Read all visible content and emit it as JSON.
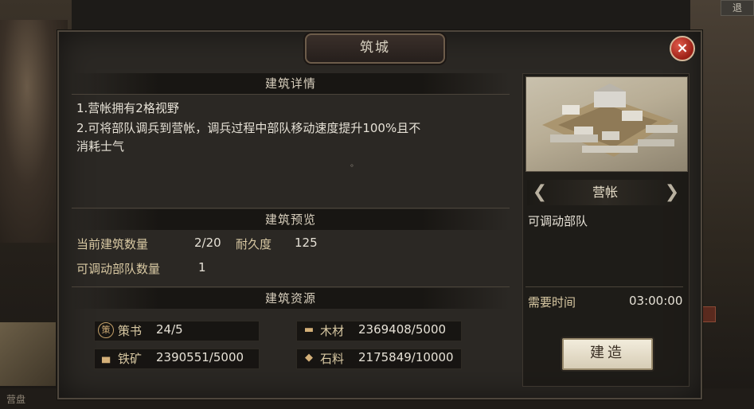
{
  "background": {
    "top_right_button": "退",
    "bottom_left_label": "营盘"
  },
  "dialog": {
    "title": "筑城",
    "close_symbol": "×"
  },
  "details": {
    "header": "建筑详情",
    "line1": "1.营帐拥有2格视野",
    "line2": "2.可将部队调兵到营帐，调兵过程中部队移动速度提升100%且不",
    "line3": "消耗士气",
    "dot": "。"
  },
  "preview": {
    "header": "建筑预览",
    "count_label": "当前建筑数量",
    "count_value": "2/20",
    "durability_label": "耐久度",
    "durability_value": "125",
    "troops_label": "可调动部队数量",
    "troops_value": "1"
  },
  "resources": {
    "header": "建筑资源",
    "items": [
      {
        "icon": "strategy-book-icon",
        "glyph": "策",
        "label": "策书",
        "value": "24/5"
      },
      {
        "icon": "wood-icon",
        "glyph": "▬",
        "label": "木材",
        "value": "2369408/5000"
      },
      {
        "icon": "iron-ore-icon",
        "glyph": "▄",
        "label": "铁矿",
        "value": "2390551/5000"
      },
      {
        "icon": "stone-icon",
        "glyph": "◆",
        "label": "石料",
        "value": "2175849/10000"
      }
    ]
  },
  "building": {
    "name": "营帐",
    "prev_arrow": "❮",
    "next_arrow": "❯",
    "ability": "可调动部队",
    "time_label": "需要时间",
    "time_value": "03:00:00",
    "build_button": "建造"
  }
}
